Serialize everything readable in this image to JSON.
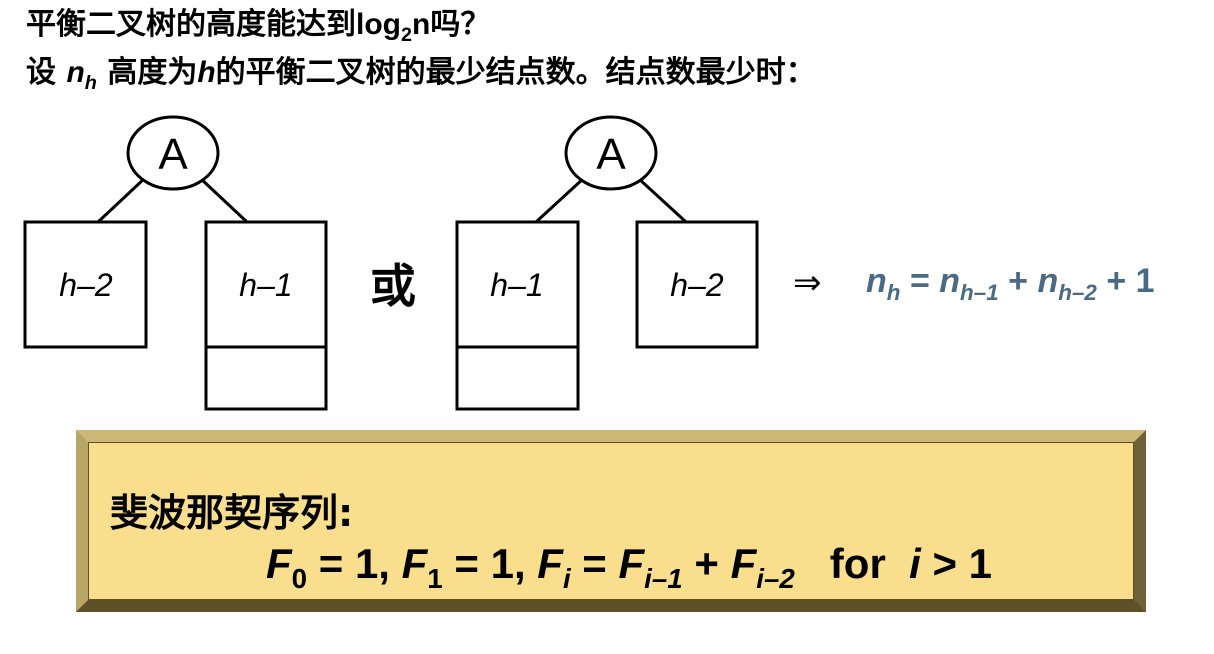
{
  "heading": {
    "line1_prefix": "平衡二叉树的高度能达到",
    "line1_log": "log",
    "line1_sub": "2",
    "line1_n": "n",
    "line1_suffix": "吗？",
    "line2_prefix": "设 ",
    "line2_var": "n",
    "line2_var_sub": "h",
    "line2_mid": " 高度为",
    "line2_h": "h",
    "line2_suffix": "的平衡二叉树的最少结点数。结点数最少时："
  },
  "diagram": {
    "left_tree": {
      "root": "A",
      "left_subtree": "h–2",
      "right_subtree": "h–1"
    },
    "or_label": "或",
    "right_tree": {
      "root": "A",
      "left_subtree": "h–1",
      "right_subtree": "h–2"
    },
    "arrow": "⇒",
    "recurrence": {
      "n1": "n",
      "s1": "h",
      "eq": " = ",
      "n2": "n",
      "s2": "h–1",
      "plus1": " + ",
      "n3": "n",
      "s3": "h–2",
      "tail": " + 1"
    },
    "colors": {
      "recurrence": "#4a6b82"
    }
  },
  "fibonacci": {
    "title": "斐波那契序列:",
    "f0": "F",
    "f0_sub": "0",
    "f0_val": " = 1,  ",
    "f1": "F",
    "f1_sub": "1",
    "f1_val": " = 1,  ",
    "fi": "F",
    "fi_sub": "i",
    "fi_eq": " = ",
    "fa": "F",
    "fa_sub": "i–1",
    "plus": " + ",
    "fb": "F",
    "fb_sub": "i–2",
    "for_word": "   for  ",
    "cond_var": "i",
    "cond_rest": " > 1",
    "colors": {
      "box": "#f9de8e",
      "bevel_dark": "#5e5128",
      "bevel_light": "#cdb877"
    }
  }
}
